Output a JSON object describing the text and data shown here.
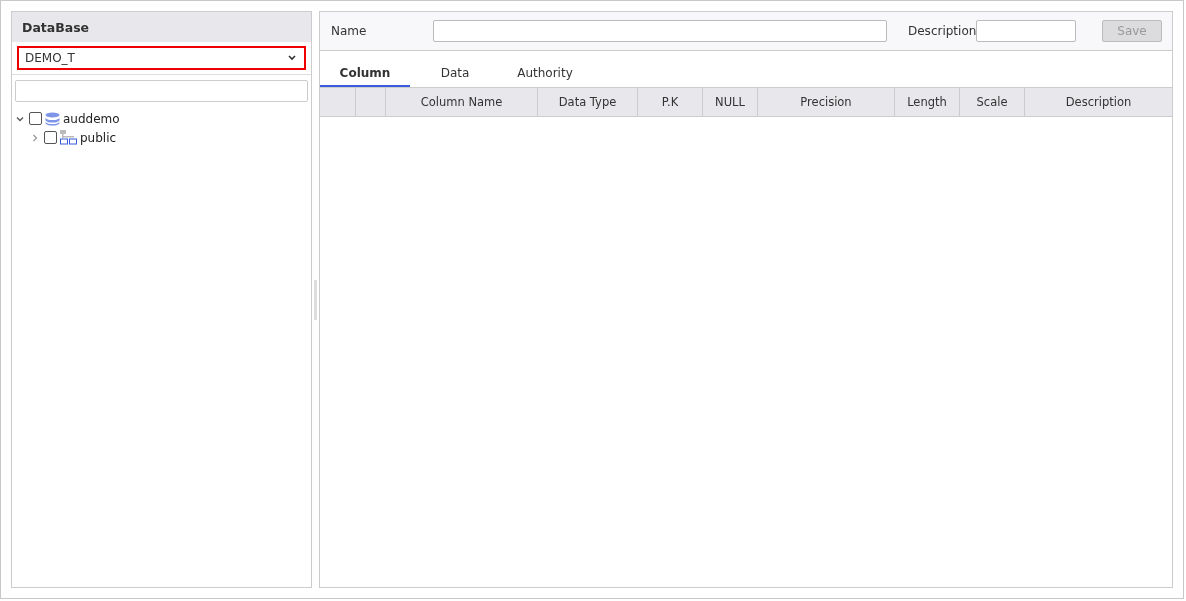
{
  "sidebar": {
    "title": "DataBase",
    "database_select": {
      "value": "DEMO_T"
    },
    "tree": [
      {
        "label": "auddemo",
        "kind": "database",
        "expanded": true,
        "checked": false,
        "children": [
          {
            "label": "public",
            "kind": "schema",
            "expanded": false,
            "checked": false
          }
        ]
      }
    ]
  },
  "form": {
    "name_label": "Name",
    "description_label": "Description",
    "save_button": {
      "label": "Save",
      "disabled": true
    }
  },
  "tabs": [
    {
      "label": "Column",
      "selected": true
    },
    {
      "label": "Data",
      "selected": false
    },
    {
      "label": "Authority",
      "selected": false
    }
  ],
  "table": {
    "columns": [
      "",
      "",
      "Column Name",
      "Data Type",
      "P.K",
      "NULL",
      "Precision",
      "Length",
      "Scale",
      "Description"
    ]
  }
}
